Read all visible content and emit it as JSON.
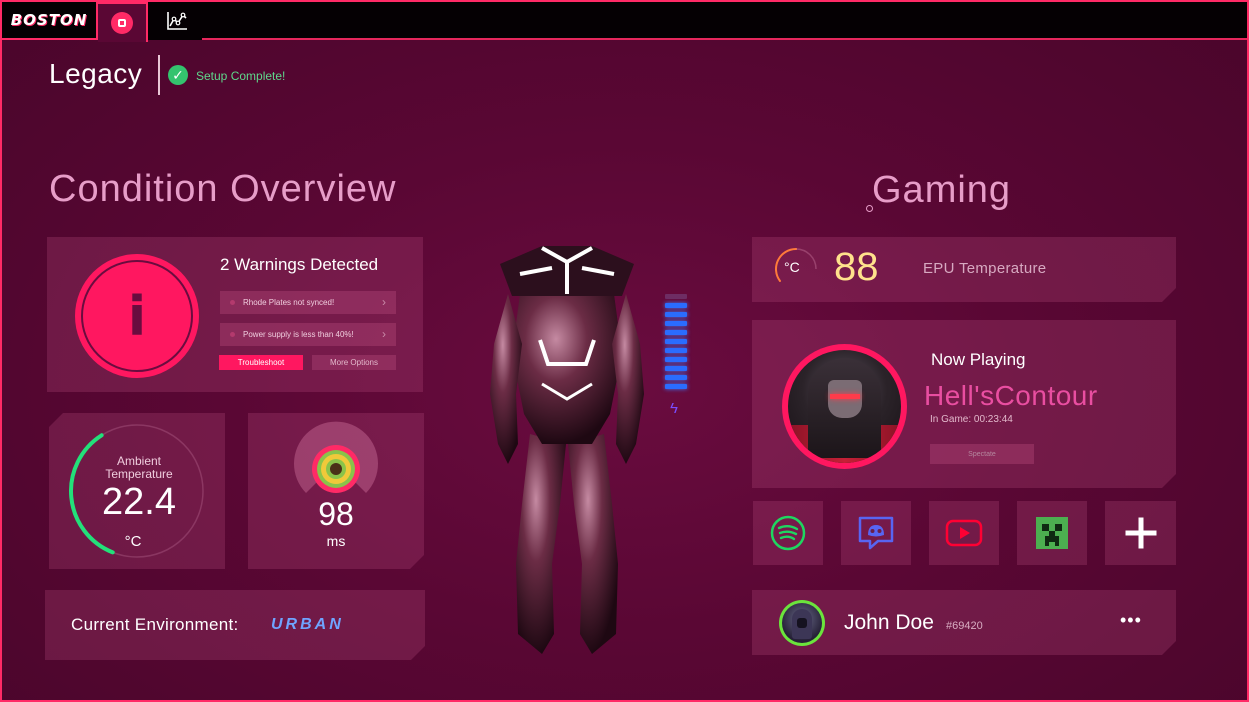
{
  "app": {
    "brand": "BOSTON",
    "tabs": [
      "home-icon",
      "chart-icon"
    ]
  },
  "header": {
    "title": "Legacy",
    "status": "Setup Complete!"
  },
  "condition": {
    "title": "Condition Overview",
    "warnings": {
      "title": "2 Warnings Detected",
      "items": [
        "Rhode Plates not synced!",
        "Power supply is less than 40%!"
      ],
      "primary_button": "Troubleshoot",
      "secondary_button": "More Options"
    },
    "ambient": {
      "label": "Ambient Temperature",
      "value": "22.4",
      "unit": "°C",
      "gauge_fraction": 0.35
    },
    "ping": {
      "value": "98",
      "unit": "ms"
    },
    "environment": {
      "label": "Current Environment:",
      "value": "URBAN"
    }
  },
  "character": {
    "battery_level": 0.9
  },
  "gaming": {
    "title": "Gaming",
    "epu": {
      "unit": "°C",
      "value": "88",
      "label": "EPU Temperature"
    },
    "now_playing": {
      "label": "Now Playing",
      "game": "Hell'sContour",
      "in_game": "In Game: 00:23:44",
      "spectate": "Spectate"
    },
    "apps": [
      "spotify-icon",
      "discord-icon",
      "youtube-icon",
      "minecraft-icon",
      "add-icon"
    ],
    "user": {
      "name": "John Doe",
      "tag": "#69420",
      "more": "•••"
    }
  },
  "colors": {
    "accent": "#ff2a66",
    "background": "#5a0734",
    "success": "#34c36e",
    "spotify": "#1ed760",
    "discord": "#5865f2",
    "youtube": "#ff0033",
    "minecraft": "#4caf50"
  }
}
